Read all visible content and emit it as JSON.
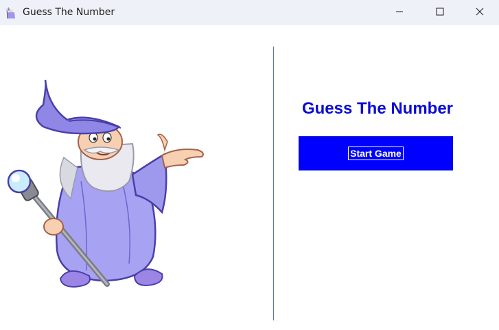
{
  "window": {
    "title": "Guess The Number",
    "icon": "wizard-app-icon",
    "controls": [
      "minimize-icon",
      "maximize-icon",
      "close-icon"
    ]
  },
  "main": {
    "illustration": "wizard-illustration",
    "heading": "Guess The Number",
    "start_button_label": "Start Game"
  },
  "colors": {
    "heading": "#0b0bd6",
    "button_bg": "#0000ff",
    "button_text": "#ffffff",
    "divider": "#5b74b8",
    "titlebar_bg": "#eef1f7"
  }
}
